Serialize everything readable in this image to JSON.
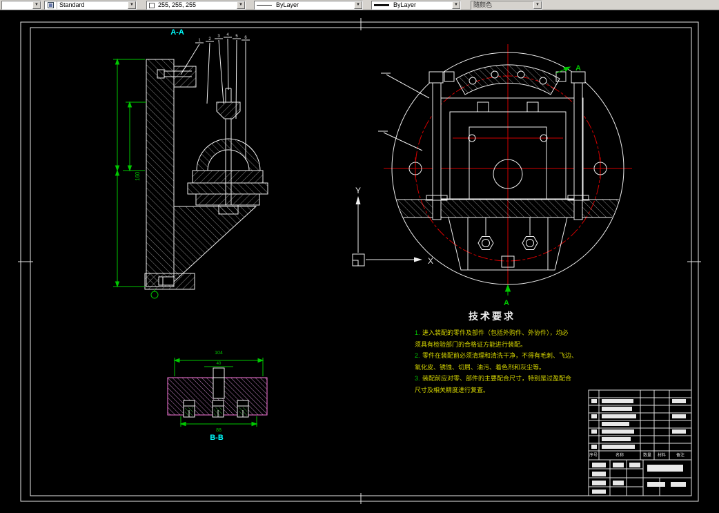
{
  "toolbar": {
    "layer_combo_value": "",
    "style_combo_value": "Standard",
    "color_combo_value": "255, 255, 255",
    "linetype_combo_value": "ByLayer",
    "lineweight_combo_value": "ByLayer",
    "plotstyle_combo_value": "随颜色",
    "arrow_glyph": "▼"
  },
  "drawing": {
    "labels": {
      "section_aa": "A-A",
      "section_bb": "B-B",
      "cut_arrow": "A",
      "ucs_y": "Y",
      "ucs_x": "X"
    },
    "balloons": [
      "1",
      "2",
      "3",
      "4",
      "5",
      "6"
    ],
    "dimensions": {
      "left_height": "160",
      "bb_width": "104",
      "bb_inner": "40",
      "bb_bottom": "88"
    },
    "tech_requirements": {
      "title": "技术要求",
      "items": [
        {
          "no": "1.",
          "text": "进入装配的零件及部件（包括外购件、外协件），均必"
        },
        {
          "no": "",
          "text": "须具有检验部门的合格证方能进行装配。"
        },
        {
          "no": "2.",
          "text": "零件在装配前必须清理和清洗干净，不得有毛刺、飞边、"
        },
        {
          "no": "",
          "text": "氧化皮、锈蚀、切屑、油污、着色剂和灰尘等。"
        },
        {
          "no": "3.",
          "text": "装配前应对零、部件的主要配合尺寸，特别是过盈配合"
        },
        {
          "no": "",
          "text": "尺寸及相关精度进行复查。"
        }
      ]
    },
    "title_block": {
      "bom_headers": [
        "序号",
        "名称",
        "数量",
        "材料",
        "备注"
      ]
    },
    "colors": {
      "line": "#f0f0f0",
      "center": "#d40000",
      "dim": "#00c800",
      "label": "#00ffff",
      "hatch_bb": "#f2a0f2",
      "note_text": "#d6d600"
    }
  }
}
